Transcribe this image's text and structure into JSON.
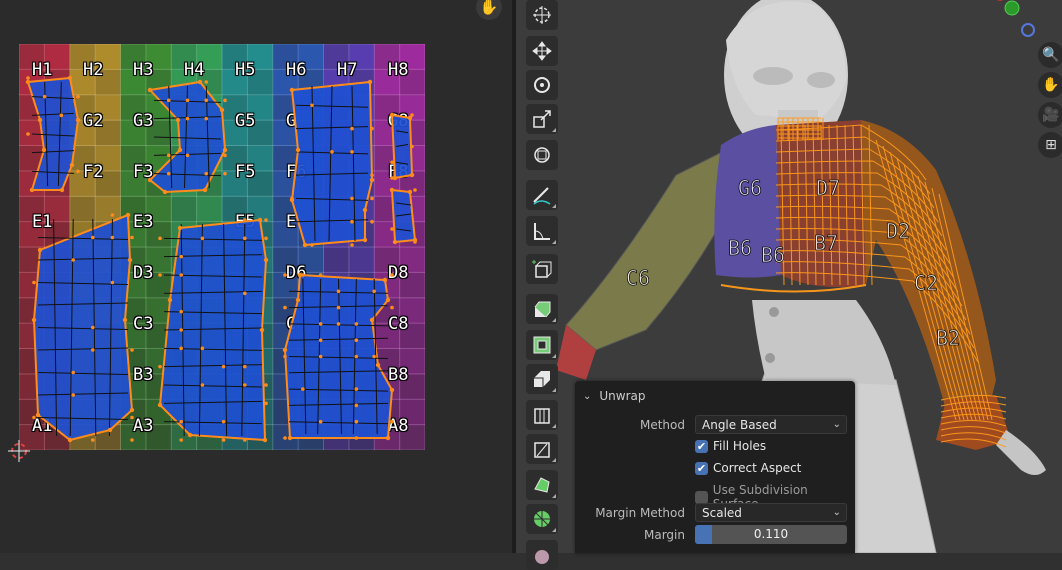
{
  "uv_editor": {
    "labels": [
      "H1",
      "H2",
      "H3",
      "H4",
      "H5",
      "H6",
      "H7",
      "H8",
      "G2",
      "G3",
      "G5",
      "G",
      "G8",
      "F2",
      "F3",
      "F5",
      "F6",
      "F8",
      "E1",
      "E3",
      "E5",
      "E",
      "D3",
      "D6",
      "D8",
      "C3",
      "C",
      "C8",
      "B3",
      "B8",
      "A1",
      "A3",
      "A8"
    ],
    "grid_colors": [
      "#c8324a",
      "#c8a032",
      "#46a03c",
      "#3cb464",
      "#28a0a0",
      "#3264c8",
      "#6446c8",
      "#b432b4"
    ]
  },
  "viewport": {
    "texture_labels": [
      "D7",
      "B7",
      "G6",
      "B6",
      "B6",
      "D2",
      "C2",
      "B2",
      "C6"
    ]
  },
  "toolbar": {
    "tools": [
      {
        "name": "cursor-tool-icon"
      },
      {
        "name": "move-tool-icon"
      },
      {
        "name": "rotate-tool-icon"
      },
      {
        "name": "scale-tool-icon"
      },
      {
        "name": "transform-tool-icon"
      },
      {
        "name": "annotate-tool-icon"
      },
      {
        "name": "measure-tool-icon"
      },
      {
        "name": "add-cube-tool-icon"
      },
      {
        "name": "extrude-region-icon"
      },
      {
        "name": "inset-faces-icon"
      },
      {
        "name": "bevel-icon"
      },
      {
        "name": "loop-cut-icon"
      },
      {
        "name": "knife-icon"
      },
      {
        "name": "poly-build-icon"
      },
      {
        "name": "spin-icon"
      },
      {
        "name": "smooth-icon"
      }
    ]
  },
  "operator_panel": {
    "title": "Unwrap",
    "method_label": "Method",
    "method_value": "Angle Based",
    "fill_holes_label": "Fill Holes",
    "fill_holes": true,
    "correct_aspect_label": "Correct Aspect",
    "correct_aspect": true,
    "use_subdiv_label": "Use Subdivision Surface",
    "use_subdiv": false,
    "margin_method_label": "Margin Method",
    "margin_method_value": "Scaled",
    "margin_label": "Margin",
    "margin_value": "0.110",
    "margin_fraction": 0.11
  },
  "colors": {
    "accent": "#4772b3",
    "uv_edge": "#ff8c1a",
    "uv_face": "#1e50d2"
  }
}
